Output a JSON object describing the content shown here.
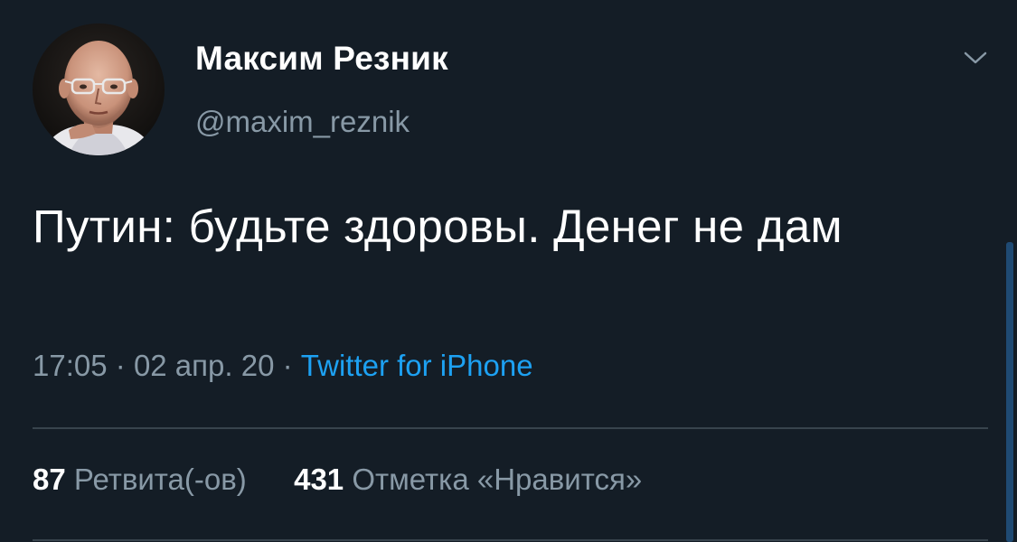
{
  "author": {
    "display_name": "Максим Резник",
    "handle": "@maxim_reznik",
    "avatar_icon": "profile-photo"
  },
  "tweet": {
    "text": "Путин: будьте здоровы. Денег не дам",
    "time": "17:05",
    "date": "02 апр. 20",
    "separator": "·",
    "source": "Twitter for iPhone"
  },
  "stats": {
    "retweets_count": "87",
    "retweets_label": "Ретвита(-ов)",
    "likes_count": "431",
    "likes_label": "Отметка «Нравится»"
  },
  "colors": {
    "background": "#141d26",
    "primary_text": "#ffffff",
    "secondary_text": "#8899a6",
    "link": "#1da1f2"
  }
}
